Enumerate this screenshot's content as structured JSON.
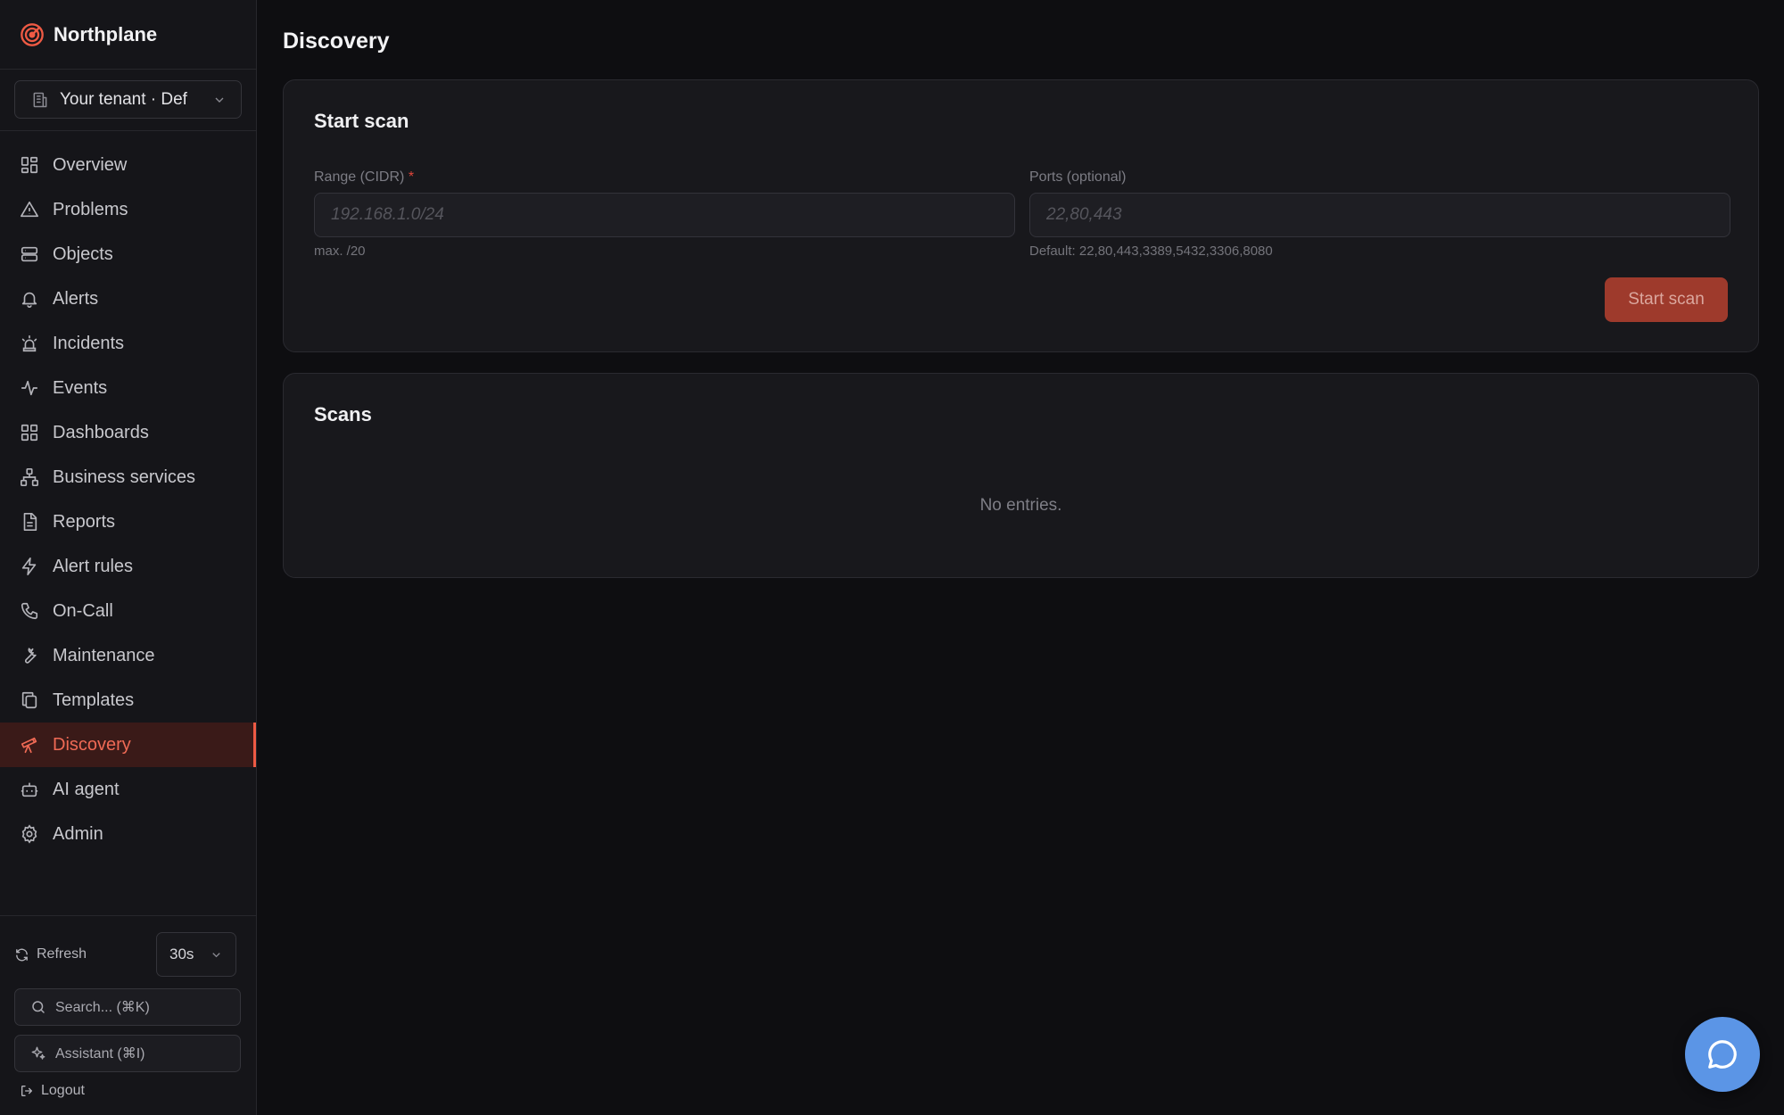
{
  "brand": {
    "name": "Northplane",
    "icon": "radar-logo-icon"
  },
  "tenant": {
    "label": "Your tenant · Def"
  },
  "nav": [
    {
      "label": "Overview",
      "icon": "grid-icon",
      "active": false
    },
    {
      "label": "Problems",
      "icon": "warning-triangle-icon",
      "active": false
    },
    {
      "label": "Objects",
      "icon": "server-icon",
      "active": false
    },
    {
      "label": "Alerts",
      "icon": "bell-icon",
      "active": false
    },
    {
      "label": "Incidents",
      "icon": "siren-icon",
      "active": false
    },
    {
      "label": "Events",
      "icon": "activity-icon",
      "active": false
    },
    {
      "label": "Dashboards",
      "icon": "dashboard-grid-icon",
      "active": false
    },
    {
      "label": "Business services",
      "icon": "hierarchy-icon",
      "active": false
    },
    {
      "label": "Reports",
      "icon": "document-icon",
      "active": false
    },
    {
      "label": "Alert rules",
      "icon": "lightning-icon",
      "active": false
    },
    {
      "label": "On-Call",
      "icon": "phone-icon",
      "active": false
    },
    {
      "label": "Maintenance",
      "icon": "wrench-icon",
      "active": false
    },
    {
      "label": "Templates",
      "icon": "copy-icon",
      "active": false
    },
    {
      "label": "Discovery",
      "icon": "telescope-icon",
      "active": true
    },
    {
      "label": "AI agent",
      "icon": "bot-icon",
      "active": false
    },
    {
      "label": "Admin",
      "icon": "gear-icon",
      "active": false
    }
  ],
  "footer": {
    "refresh_label": "Refresh",
    "interval_value": "30s",
    "search_label": "Search... (⌘K)",
    "assistant_label": "Assistant (⌘I)",
    "logout_label": "Logout"
  },
  "page": {
    "title": "Discovery"
  },
  "scan_form": {
    "title": "Start scan",
    "range_label": "Range (CIDR)",
    "range_required_mark": "*",
    "range_placeholder": "192.168.1.0/24",
    "range_value": "",
    "range_hint": "max. /20",
    "ports_label": "Ports (optional)",
    "ports_placeholder": "22,80,443",
    "ports_value": "",
    "ports_hint": "Default: 22,80,443,3389,5432,3306,8080",
    "submit_label": "Start scan"
  },
  "scans": {
    "title": "Scans",
    "empty_text": "No entries."
  },
  "colors": {
    "accent": "#ee5a44",
    "fab": "#5b95e6",
    "background": "#0e0e11"
  }
}
